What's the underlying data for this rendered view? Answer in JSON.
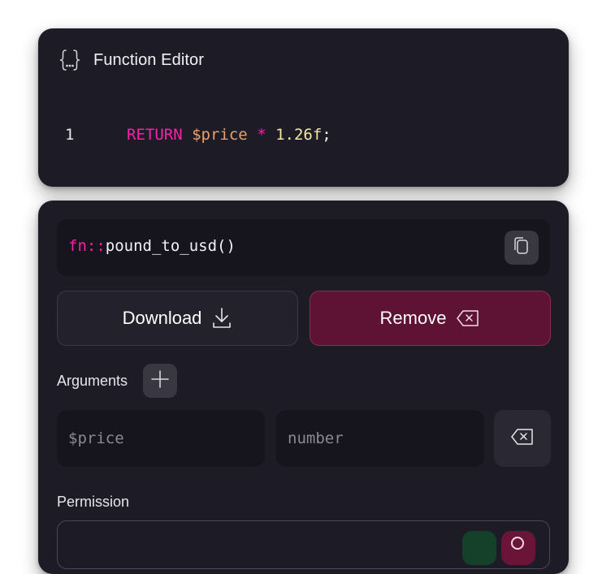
{
  "editor": {
    "title": "Function Editor",
    "icon": "curly-braces-icon",
    "code": {
      "line_number": "1",
      "keyword": "RETURN",
      "variable": "$price",
      "operator": "*",
      "number": "1.26f",
      "terminator": ";"
    }
  },
  "function": {
    "prefix": "fn::",
    "name": "pound_to_usd()",
    "copy_icon": "copy-icon"
  },
  "actions": {
    "download_label": "Download",
    "download_icon": "download-icon",
    "remove_label": "Remove",
    "remove_icon": "backspace-icon"
  },
  "arguments": {
    "label": "Arguments",
    "add_icon": "plus-icon",
    "items": [
      {
        "name_placeholder": "$price",
        "type_placeholder": "number",
        "remove_icon": "backspace-icon"
      }
    ]
  },
  "permission": {
    "label": "Permission"
  },
  "colors": {
    "card_bg": "#1d1b26",
    "accent_pink": "#ff1fa9",
    "remove_bg": "#5e1234",
    "allow_bg": "#15402a",
    "deny_bg": "#6a1538"
  }
}
